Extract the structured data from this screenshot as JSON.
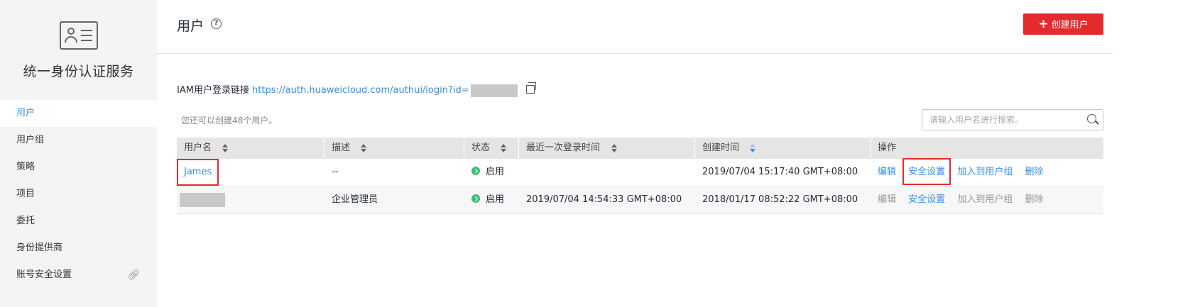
{
  "sidebar": {
    "title": "统一身份认证服务",
    "items": [
      {
        "label": "用户",
        "active": true
      },
      {
        "label": "用户组"
      },
      {
        "label": "策略"
      },
      {
        "label": "项目"
      },
      {
        "label": "委托"
      },
      {
        "label": "身份提供商"
      },
      {
        "label": "账号安全设置"
      }
    ]
  },
  "header": {
    "title": "用户",
    "help_icon": "?",
    "create_button": "创建用户",
    "create_icon": "+"
  },
  "login_link": {
    "label": "IAM用户登录链接",
    "url": "https://auth.huaweicloud.com/authui/login?id="
  },
  "quota_hint": "您还可以创建48个用户。",
  "search": {
    "placeholder": "请输入用户名进行搜索。"
  },
  "table": {
    "columns": [
      "用户名",
      "描述",
      "状态",
      "最近一次登录时间",
      "创建时间",
      "操作"
    ],
    "rows": [
      {
        "username": "James",
        "description": "--",
        "status": "启用",
        "last_login": "",
        "created": "2019/07/04 15:17:40 GMT+08:00",
        "actions": [
          "编辑",
          "安全设置",
          "加入到用户组",
          "删除"
        ]
      },
      {
        "username": "",
        "description": "企业管理员",
        "status": "启用",
        "last_login": "2019/07/04 14:54:33 GMT+08:00",
        "created": "2018/01/17 08:52:22 GMT+08:00",
        "actions": [
          "编辑",
          "安全设置",
          "加入到用户组",
          "删除"
        ]
      }
    ]
  },
  "colors": {
    "accent": "#3a8ee6",
    "primary_button": "#e32b2d",
    "status_enabled": "#3dbd7d",
    "highlight": "#e32b2d"
  }
}
